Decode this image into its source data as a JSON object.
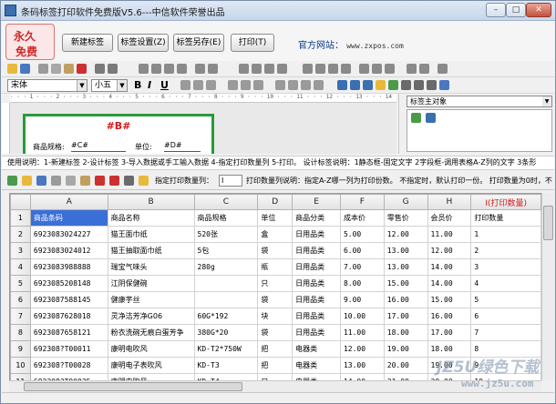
{
  "window": {
    "title": "条码标签打印软件免费版V5.6---中信软件荣誉出品",
    "min_label": "–",
    "max_label": "□",
    "close_label": "✕"
  },
  "banner": {
    "logo_line1": "永久",
    "logo_line2": "免费",
    "buttons": [
      "新建标签",
      "标签设置(Z)",
      "标签另存(E)",
      "打印(T)"
    ],
    "site_label": "官方网站：",
    "site_url": "www.zxpos.com"
  },
  "format_bar": {
    "font": "宋体",
    "size": "小五",
    "bold": "B",
    "italic": "I",
    "underline": "U"
  },
  "ruler_text": "· · · 1 · · · 2 · · · 3 · · · 4 · · · 5 · · · 6 · · · 7 · · · 8 · · · 9 · · · 10 · · · 11 · · · 12 · · · 13 · · · 14 · · · 15",
  "label_preview": {
    "title": "#B#",
    "field1_label": "商品规格:",
    "field1_value": "#C#",
    "field2_label": "单位:",
    "field2_value": "#D#"
  },
  "object_panel": {
    "combo_value": "标签主对象"
  },
  "help_text": "使用说明：1-新建标签 2-设计标签 3-导入数据或手工输入数据 4-指定打印数量列 5-打印。 设计标签说明：1静态框-固定文字 2字段框-调用表格A-Z列的文字 3条形",
  "grid_toolbar": {
    "qty_label": "指定打印数量列：",
    "qty_value": "I",
    "qty_note": "打印数量列说明：指定A-Z哪一列为打印份数。 不指定时，默认打印一份。 打印数量为0时，不"
  },
  "grid": {
    "columns": [
      "",
      "A",
      "B",
      "C",
      "D",
      "E",
      "F",
      "G",
      "H",
      "I(打印数量)"
    ],
    "rows": [
      [
        "1",
        "商品条码",
        "商品名称",
        "商品规格",
        "单位",
        "商品分类",
        "成本价",
        "零售价",
        "会员价",
        "打印数量"
      ],
      [
        "2",
        "6923083024227",
        "猫王面巾纸",
        "520张",
        "盒",
        "日用品类",
        "5.00",
        "12.00",
        "11.00",
        "1"
      ],
      [
        "3",
        "6923083024012",
        "猫王抽取面巾纸",
        "5包",
        "袋",
        "日用品类",
        "6.00",
        "13.00",
        "12.00",
        "2"
      ],
      [
        "4",
        "6923083988888",
        "瑞宝气味头",
        "280g",
        "瓶",
        "日用品类",
        "7.00",
        "13.00",
        "14.00",
        "3"
      ],
      [
        "5",
        "6923085208148",
        "江阴保健碗",
        "",
        "只",
        "日用品类",
        "8.00",
        "15.00",
        "14.00",
        "4"
      ],
      [
        "6",
        "6923087588145",
        "健康芋丝",
        "",
        "袋",
        "日用品类",
        "9.00",
        "16.00",
        "15.00",
        "5"
      ],
      [
        "7",
        "6923087628018",
        "灵净洁芳净G06",
        "60G*192",
        "块",
        "日用品类",
        "10.00",
        "17.00",
        "16.00",
        "6"
      ],
      [
        "8",
        "6923087658121",
        "粉衣洗碗无痕白蛋芳争",
        "380G*20",
        "袋",
        "日用品类",
        "11.00",
        "18.00",
        "17.00",
        "7"
      ],
      [
        "9",
        "692308?T00011",
        "康明电吹风",
        "KD-T2*750W",
        "把",
        "电器类",
        "12.00",
        "19.00",
        "18.00",
        "8"
      ],
      [
        "10",
        "692308?T00028",
        "康明电子表吹风",
        "KD-T3",
        "把",
        "电器类",
        "13.00",
        "20.00",
        "19.00",
        "9"
      ],
      [
        "11",
        "692308?T00035",
        "康明电吹风",
        "KD-T4",
        "只",
        "电器类",
        "14.00",
        "21.00",
        "20.00",
        "10"
      ]
    ]
  },
  "watermark": {
    "line1": "JZ5U绿色下载",
    "line2": "www.jz5u.com"
  }
}
